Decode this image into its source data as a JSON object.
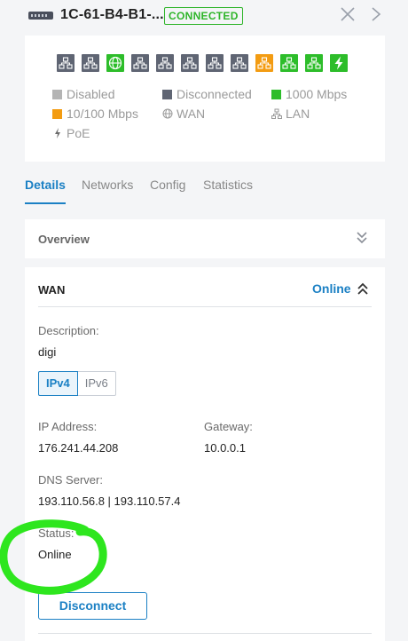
{
  "header": {
    "device_name": "1C-61-B4-B1-...",
    "status": "CONNECTED"
  },
  "ports": [
    {
      "kind": "lan",
      "color": "#5f6573"
    },
    {
      "kind": "lan",
      "color": "#5f6573"
    },
    {
      "kind": "wan",
      "color": "#2dbd2a"
    },
    {
      "kind": "lan",
      "color": "#5f6573"
    },
    {
      "kind": "lan",
      "color": "#5f6573"
    },
    {
      "kind": "lan",
      "color": "#5f6573"
    },
    {
      "kind": "lan",
      "color": "#5f6573"
    },
    {
      "kind": "lan",
      "color": "#5f6573"
    },
    {
      "kind": "lan",
      "color": "#f39c12"
    },
    {
      "kind": "lan",
      "color": "#2dbd2a"
    },
    {
      "kind": "lan",
      "color": "#2dbd2a"
    },
    {
      "kind": "poe",
      "color": "#2dbd2a"
    }
  ],
  "legend": {
    "disabled": "Disabled",
    "disconnected": "Disconnected",
    "gbps": "1000 Mbps",
    "mbps100": "10/100 Mbps",
    "wan": "WAN",
    "lan": "LAN",
    "poe": "PoE",
    "colors": {
      "disabled": "#b4b4b4",
      "disconnected": "#5f6573",
      "gbps": "#2dbd2a",
      "mbps100": "#f39c12"
    }
  },
  "tabs": [
    {
      "label": "Details",
      "active": true
    },
    {
      "label": "Networks",
      "active": false
    },
    {
      "label": "Config",
      "active": false
    },
    {
      "label": "Statistics",
      "active": false
    }
  ],
  "overview": {
    "title": "Overview"
  },
  "wan": {
    "title": "WAN",
    "status": "Online",
    "description_label": "Description:",
    "description_value": "digi",
    "ipv4_label": "IPv4",
    "ipv6_label": "IPv6",
    "ip_label": "IP Address:",
    "ip_value": "176.241.44.208",
    "gateway_label": "Gateway:",
    "gateway_value": "10.0.0.1",
    "dns_label": "DNS Server:",
    "dns_value": "193.110.56.8 | 193.110.57.4",
    "status_label": "Status:",
    "status_value": "Online",
    "disconnect_label": "Disconnect"
  },
  "colors": {
    "accent": "#1b80c4",
    "connected": "#2fb52a",
    "annotation": "#2ee61e"
  }
}
